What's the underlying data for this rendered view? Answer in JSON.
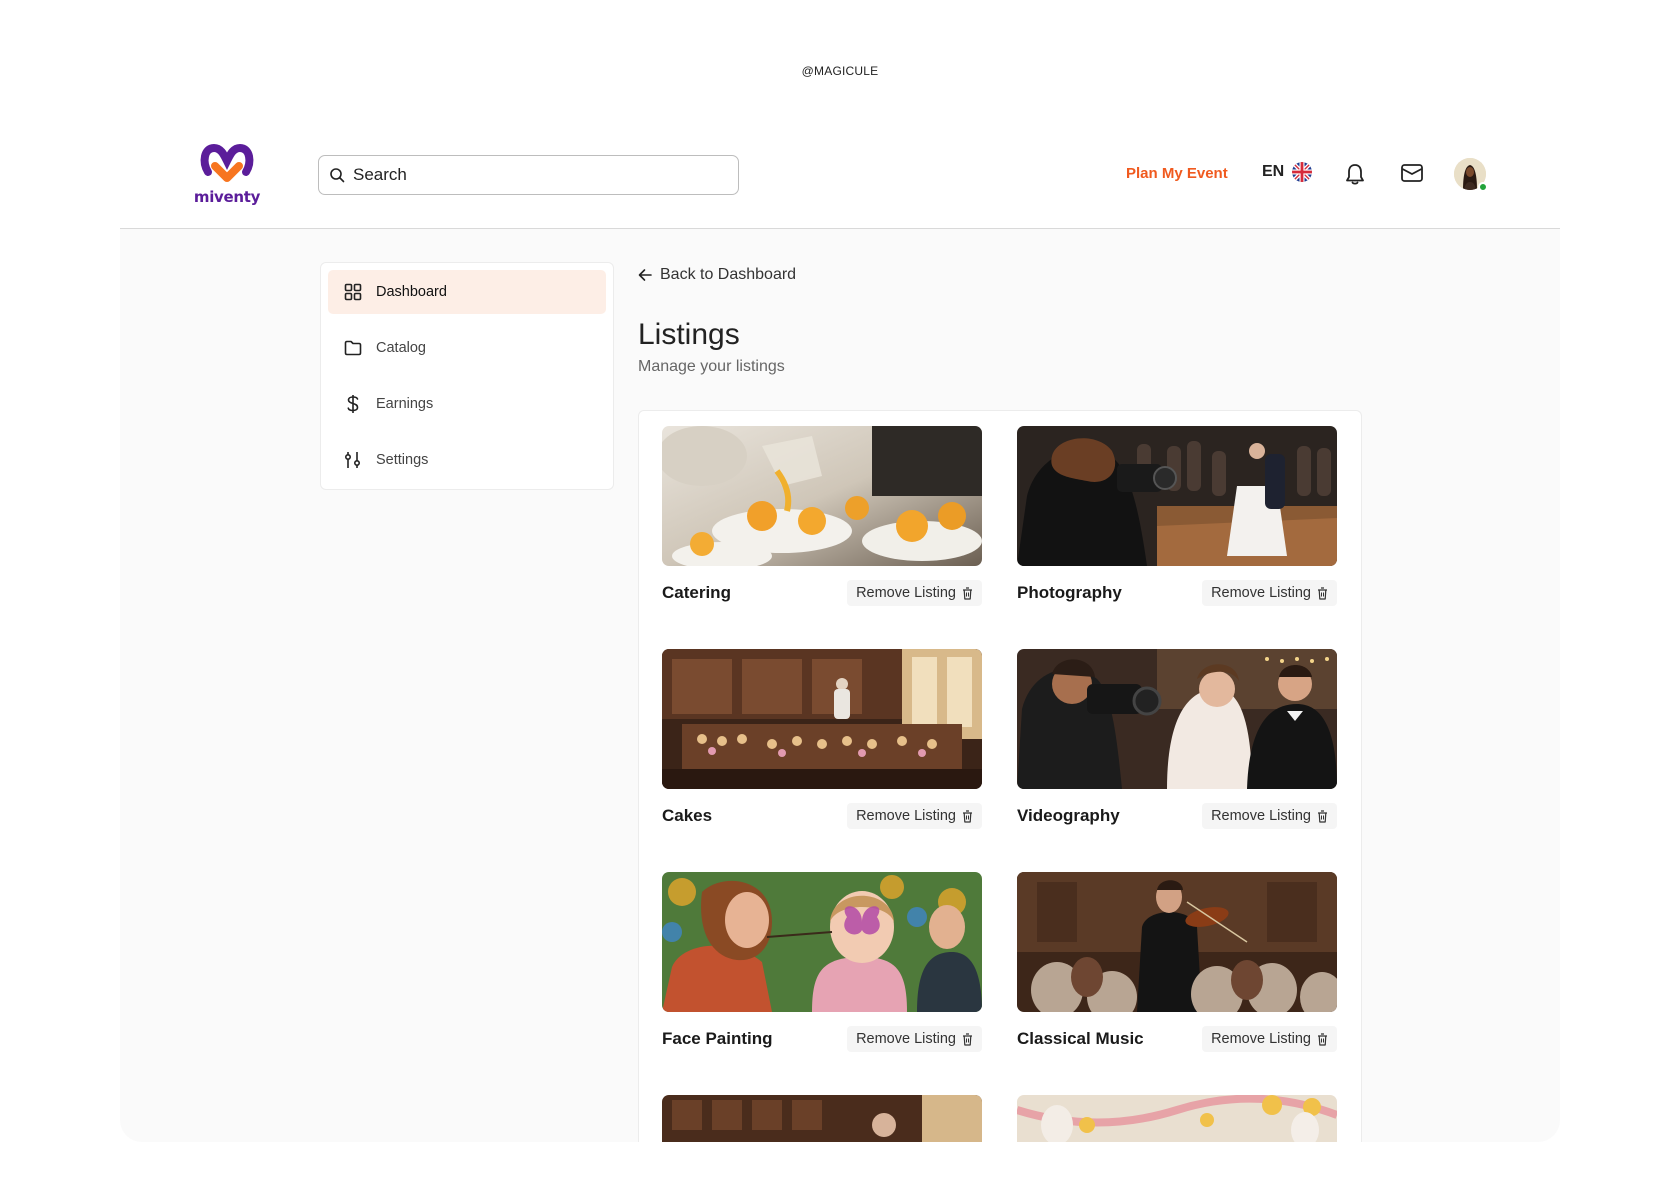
{
  "watermark": "@MAGICULE",
  "brand": {
    "name": "miventy",
    "primary": "#5b1d9a",
    "accent": "#f05a1f"
  },
  "header": {
    "search_placeholder": "Search",
    "plan_label": "Plan My Event",
    "language": "EN",
    "icons": [
      "search-icon",
      "uk-flag-icon",
      "bell-icon",
      "mail-icon",
      "avatar"
    ]
  },
  "sidebar": {
    "items": [
      {
        "label": "Dashboard",
        "icon": "grid-icon",
        "active": true
      },
      {
        "label": "Catalog",
        "icon": "folder-icon",
        "active": false
      },
      {
        "label": "Earnings",
        "icon": "dollar-icon",
        "active": false
      },
      {
        "label": "Settings",
        "icon": "sliders-icon",
        "active": false
      }
    ]
  },
  "main": {
    "back_label": "Back to Dashboard",
    "title": "Listings",
    "subtitle": "Manage your listings",
    "remove_label": "Remove Listing",
    "listings": [
      {
        "name": "Catering"
      },
      {
        "name": "Photography"
      },
      {
        "name": "Cakes"
      },
      {
        "name": "Videography"
      },
      {
        "name": "Face Painting"
      },
      {
        "name": "Classical Music"
      }
    ]
  }
}
